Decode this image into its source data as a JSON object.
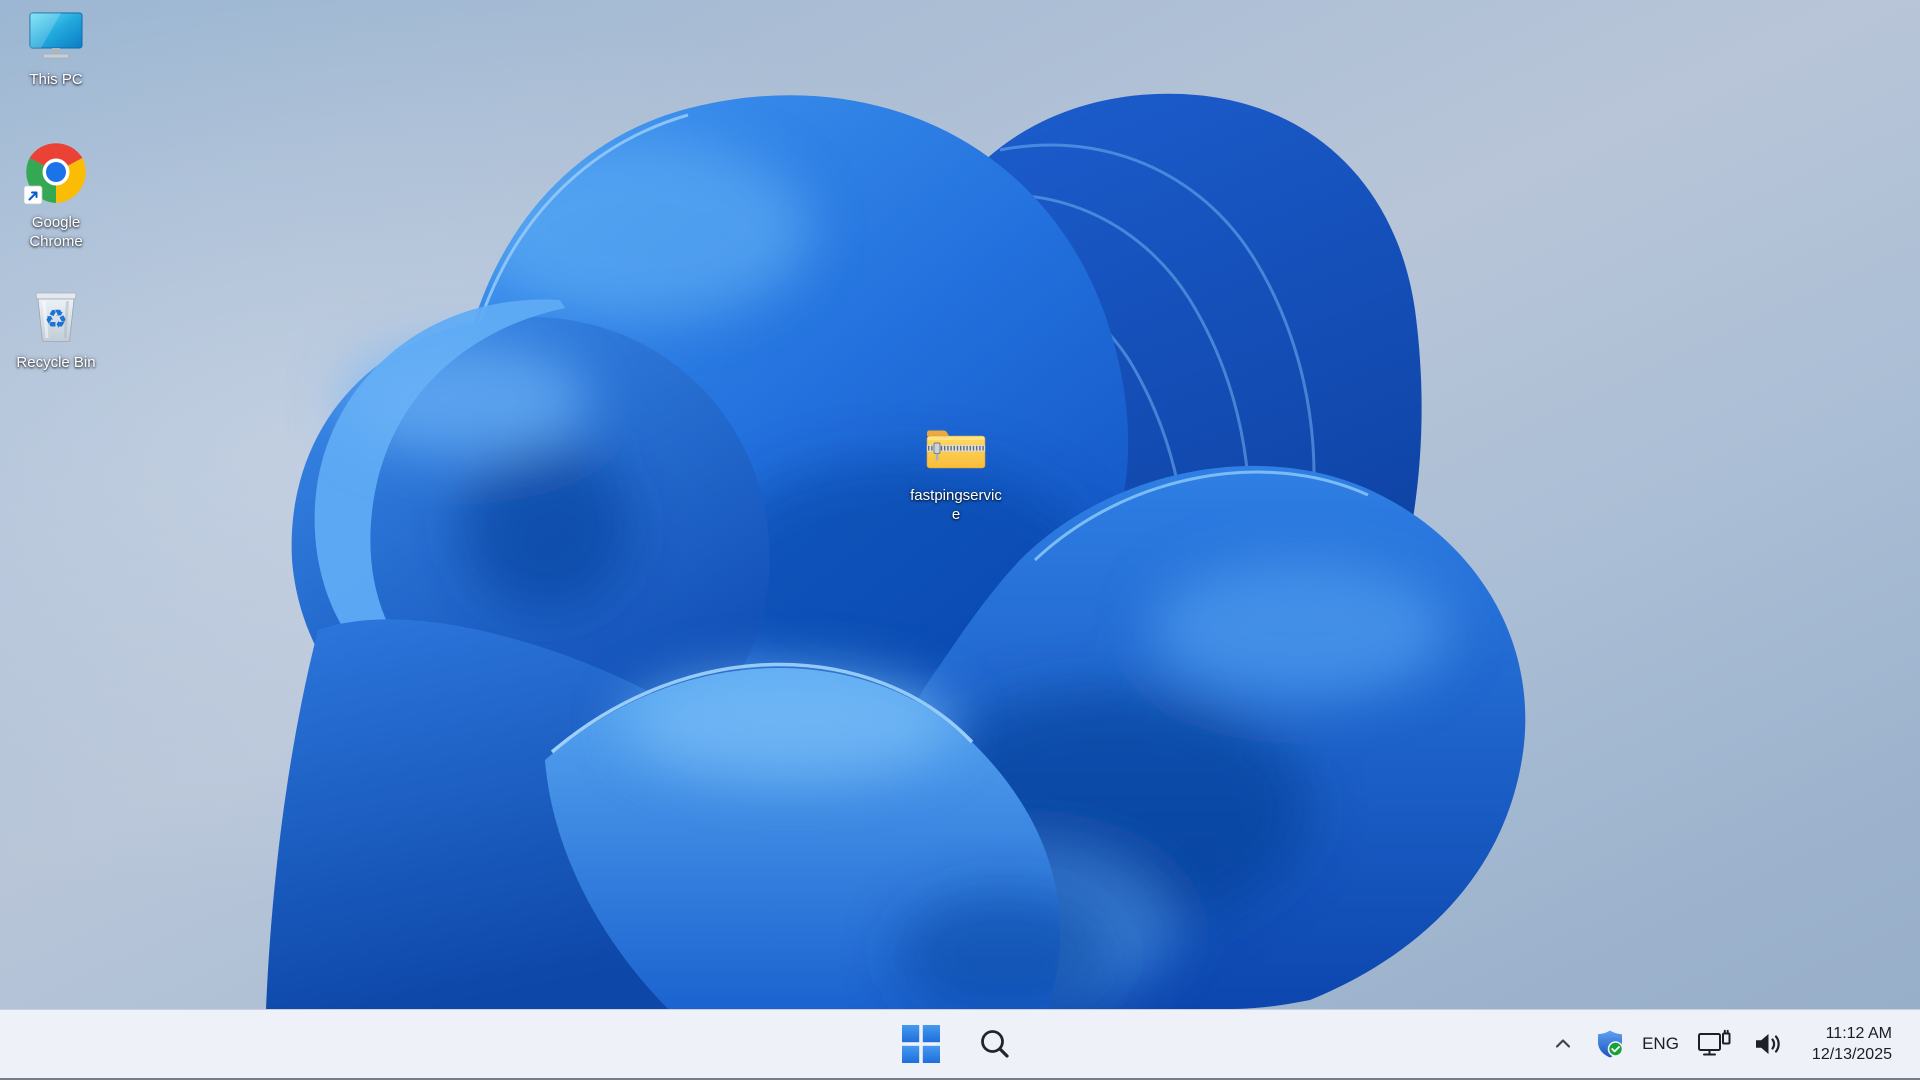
{
  "desktop": {
    "icons": [
      {
        "name": "this-pc",
        "label": "This PC"
      },
      {
        "name": "google-chrome",
        "label": "Google Chrome"
      },
      {
        "name": "recycle-bin",
        "label": "Recycle Bin"
      }
    ],
    "files": [
      {
        "name": "zip-folder",
        "label": "fastpingservice",
        "display_lines": [
          "fastpingservic",
          "e"
        ]
      }
    ]
  },
  "taskbar": {
    "tray": {
      "language": "ENG",
      "time": "11:12 AM",
      "date": "12/13/2025"
    }
  },
  "colors": {
    "petal_accent": "#2e7ee3",
    "taskbar_bg": "#eef1f8",
    "start_blue_light": "#459af0",
    "start_blue_dark": "#1f6edb",
    "chrome_red": "#ea4335",
    "chrome_yellow": "#fbbc05",
    "chrome_green": "#34a853",
    "chrome_blue": "#1a73e8",
    "folder_yellow": "#fdc944",
    "shield_blue": "#2f6fd8",
    "check_green": "#17a235",
    "recycle_arrow_blue": "#1a74d6"
  }
}
